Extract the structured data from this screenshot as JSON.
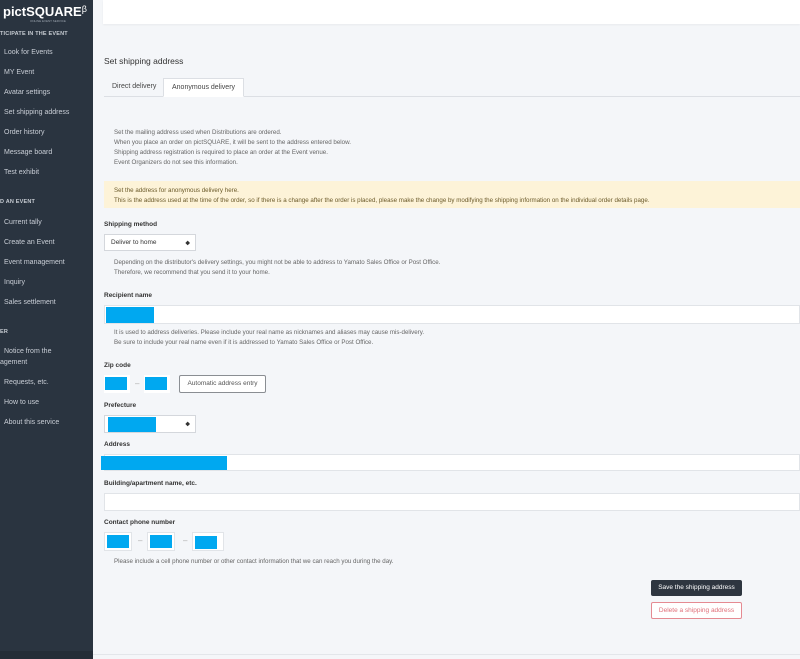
{
  "app": {
    "logo": "pictSQUARE",
    "logo_beta": "β",
    "logo_sub": "ONLINE EVENT SERVICE"
  },
  "sidebar": {
    "section1": "TICIPATE IN THE EVENT",
    "items1": [
      "Look for Events",
      "MY Event",
      "Avatar settings",
      "Set shipping address",
      "Order history",
      "Message board",
      "Test exhibit"
    ],
    "section2": "D AN EVENT",
    "items2": [
      "Current tally",
      "Create an Event",
      "Event management",
      "Inquiry",
      "Sales settlement"
    ],
    "section3": "ER",
    "items3": [
      "Notice from the",
      "agement",
      "Requests, etc.",
      "How to use",
      "About this service"
    ]
  },
  "main": {
    "title": "Set shipping address",
    "tabs": [
      {
        "label": "Direct delivery"
      },
      {
        "label": "Anonymous delivery"
      }
    ],
    "intro": [
      "Set the mailing address used when Distributions are ordered.",
      "When you place an order on pictSQUARE, it will be sent to the address entered below.",
      "Shipping address registration is required to place an order at the Event venue.",
      "Event Organizers do not see this information."
    ],
    "warning": [
      "Set the address for anonymous delivery here.",
      "This is the address used at the time of the order, so if there is a change after the order is placed, please make the change by modifying the shipping information on the individual order details page."
    ],
    "shipping_method": {
      "label": "Shipping method",
      "value": "Deliver to home",
      "help": [
        "Depending on the distributor's delivery settings, you might not be able to address to Yamato Sales Office or Post Office.",
        "Therefore, we recommend that you send it to your home."
      ]
    },
    "recipient": {
      "label": "Recipient name",
      "help": [
        "It is used to address deliveries. Please include your real name as nicknames and aliases may cause mis-delivery.",
        "Be sure to include your real name even if it is addressed to Yamato Sales Office or Post Office."
      ]
    },
    "zip": {
      "label": "Zip code",
      "dash": "–",
      "auto_button": "Automatic address entry"
    },
    "prefecture": {
      "label": "Prefecture"
    },
    "address": {
      "label": "Address"
    },
    "building": {
      "label": "Building/apartment name, etc."
    },
    "phone": {
      "label": "Contact phone number",
      "dash": "–",
      "help": "Please include a cell phone number or other contact information that we can reach you during the day."
    },
    "save_button": "Save the shipping address",
    "delete_button": "Delete a shipping address"
  },
  "colors": {
    "sidebar_bg": "#2a3440",
    "redaction": "#00a8f0",
    "warning_bg": "#fdf3d8",
    "save_bg": "#2e3640",
    "delete_text": "#e0707a"
  }
}
